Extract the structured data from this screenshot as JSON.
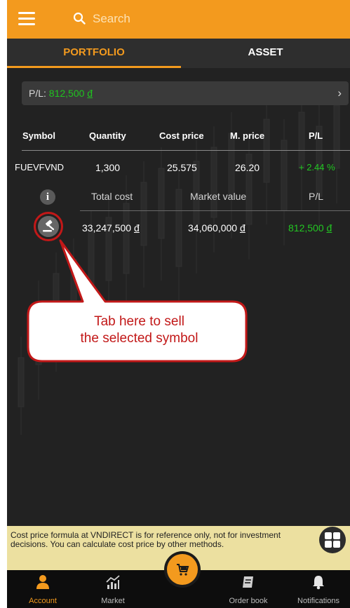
{
  "header": {
    "search_placeholder": "Search",
    "accent_color": "#f39a1e"
  },
  "tabs": [
    {
      "label": "PORTFOLIO",
      "active": true
    },
    {
      "label": "ASSET",
      "active": false
    }
  ],
  "pl_summary": {
    "label": "P/L:",
    "value": "812,500",
    "currency": "đ"
  },
  "table": {
    "headers": [
      "Symbol",
      "Quantity",
      "Cost price",
      "M. price",
      "P/L"
    ],
    "rows": [
      {
        "symbol": "FUEVFVND",
        "quantity": "1,300",
        "cost_price": "25.575",
        "market_price": "26.20",
        "pl": "+ 2.44 %"
      }
    ]
  },
  "detail": {
    "headers": [
      "Total cost",
      "Market value",
      "P/L"
    ],
    "total_cost": "33,247,500",
    "market_value": "34,060,000",
    "pl": "812,500",
    "currency": "đ"
  },
  "callout": {
    "line1": "Tab here to sell",
    "line2": "the selected symbol"
  },
  "notice": {
    "text": "Cost price formula at VNDIRECT is for reference only, not for investment decisions. You can calculate cost price by other methods."
  },
  "navbar": [
    {
      "label": "Account",
      "icon": "person-icon",
      "active": true
    },
    {
      "label": "Market",
      "icon": "market-chart-icon",
      "active": false
    },
    {
      "label": "",
      "icon": "cart-icon",
      "active": false
    },
    {
      "label": "Order book",
      "icon": "order-book-icon",
      "active": false
    },
    {
      "label": "Notifications",
      "icon": "bell-icon",
      "active": false
    }
  ]
}
